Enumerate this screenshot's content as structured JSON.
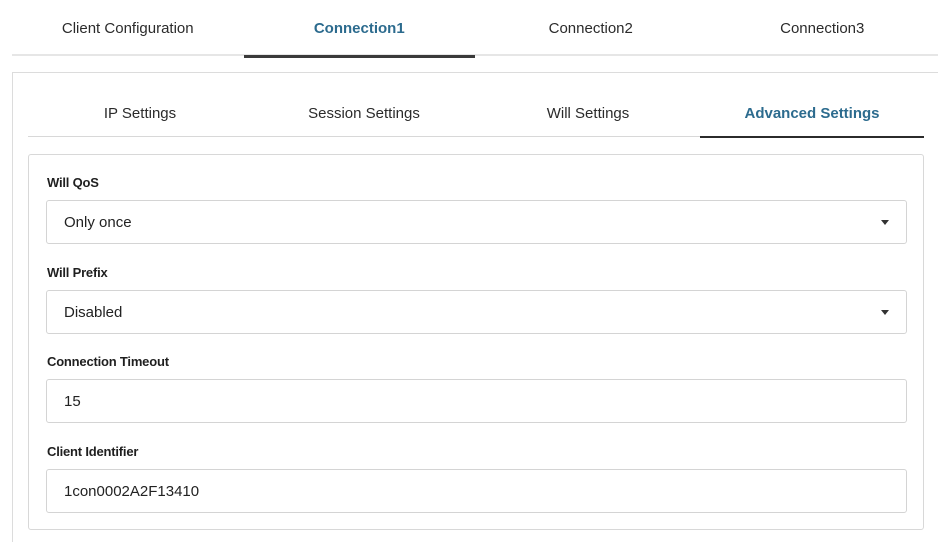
{
  "top_tabs": [
    {
      "label": "Client Configuration",
      "active": false
    },
    {
      "label": "Connection1",
      "active": true
    },
    {
      "label": "Connection2",
      "active": false
    },
    {
      "label": "Connection3",
      "active": false
    }
  ],
  "sub_tabs": [
    {
      "label": "IP Settings",
      "active": false
    },
    {
      "label": "Session Settings",
      "active": false
    },
    {
      "label": "Will Settings",
      "active": false
    },
    {
      "label": "Advanced Settings",
      "active": true
    }
  ],
  "form": {
    "will_qos": {
      "label": "Will QoS",
      "value": "Only once"
    },
    "will_prefix": {
      "label": "Will Prefix",
      "value": "Disabled"
    },
    "connection_timeout": {
      "label": "Connection Timeout",
      "value": "15"
    },
    "client_identifier": {
      "label": "Client Identifier",
      "value": "1con0002A2F13410"
    }
  },
  "colors": {
    "accent": "#2c6b8e",
    "tab_underline": "#3a3a3a",
    "border": "#d4d4d4"
  }
}
